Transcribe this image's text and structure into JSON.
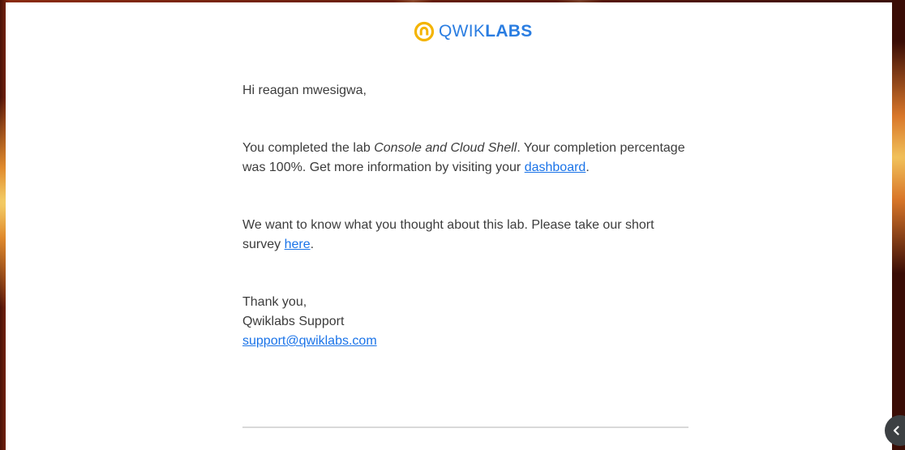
{
  "brand": {
    "name_light": "QWIK",
    "name_bold": "LABS",
    "logo_icon": "qwiklabs-logo-icon",
    "accent_color": "#f4b400",
    "text_color": "#2a7de1"
  },
  "email": {
    "greeting": "Hi reagan mwesigwa,",
    "completion": {
      "prefix": "You completed the lab ",
      "lab_name": "Console and Cloud Shell",
      "middle": ". Your completion percentage was 100%. Get more information by visiting your ",
      "link_text": "dashboard",
      "suffix": "."
    },
    "survey": {
      "prefix": "We want to know what you thought about this lab. Please take our short survey ",
      "link_text": "here",
      "suffix": "."
    },
    "signoff": {
      "thanks": "Thank you,",
      "team": "Qwiklabs Support",
      "email_link": "support@qwiklabs.com"
    }
  },
  "side_panel_toggle": {
    "icon": "chevron-left-icon"
  }
}
